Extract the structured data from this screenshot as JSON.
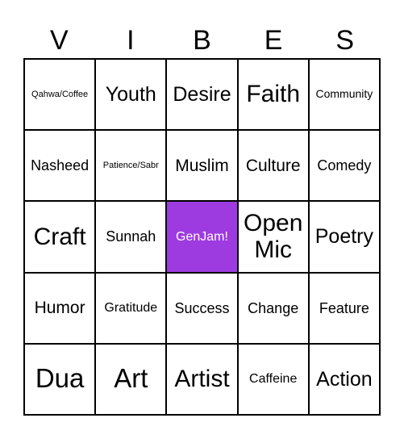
{
  "title_letters": [
    "V",
    "I",
    "B",
    "E",
    "S"
  ],
  "free_space_color": "#9d3be0",
  "cells": [
    {
      "text": "Qahwa/Coffee",
      "size": "s-xs"
    },
    {
      "text": "Youth",
      "size": "s-lg"
    },
    {
      "text": "Desire",
      "size": "s-lg"
    },
    {
      "text": "Faith",
      "size": "s-xl"
    },
    {
      "text": "Community",
      "size": "s-xs2"
    },
    {
      "text": "Nasheed",
      "size": "s-md"
    },
    {
      "text": "Patience/Sabr",
      "size": "s-xs"
    },
    {
      "text": "Muslim",
      "size": "s-md2"
    },
    {
      "text": "Culture",
      "size": "s-md2"
    },
    {
      "text": "Comedy",
      "size": "s-md"
    },
    {
      "text": "Craft",
      "size": "s-xl"
    },
    {
      "text": "Sunnah",
      "size": "s-md"
    },
    {
      "text": "GenJam!",
      "size": "s-sm",
      "free": true
    },
    {
      "text": "Open Mic",
      "size": "s-xl"
    },
    {
      "text": "Poetry",
      "size": "s-lg"
    },
    {
      "text": "Humor",
      "size": "s-md2"
    },
    {
      "text": "Gratitude",
      "size": "s-sm"
    },
    {
      "text": "Success",
      "size": "s-md"
    },
    {
      "text": "Change",
      "size": "s-md"
    },
    {
      "text": "Feature",
      "size": "s-md"
    },
    {
      "text": "Dua",
      "size": "s-xxl"
    },
    {
      "text": "Art",
      "size": "s-xxl"
    },
    {
      "text": "Artist",
      "size": "s-xl"
    },
    {
      "text": "Caffeine",
      "size": "s-sm"
    },
    {
      "text": "Action",
      "size": "s-lg"
    }
  ]
}
